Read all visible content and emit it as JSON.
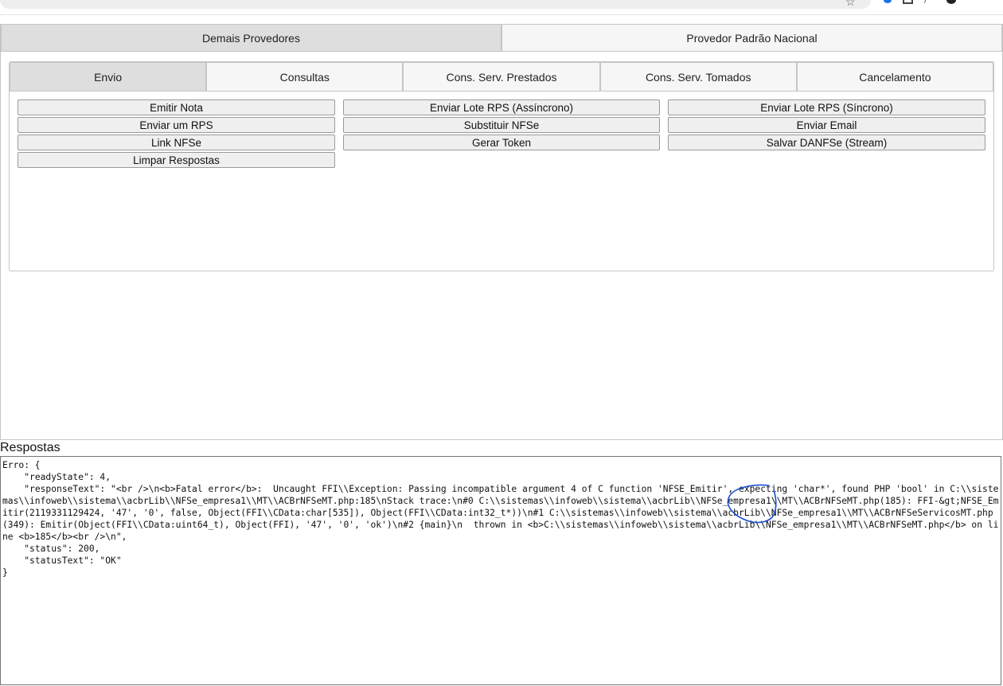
{
  "browser": {
    "star_glyph": "☆"
  },
  "top_tabs": [
    {
      "label": "Demais Provedores",
      "active": true
    },
    {
      "label": "Provedor Padrão Nacional",
      "active": false
    }
  ],
  "sub_tabs": [
    {
      "label": "Envio",
      "active": true
    },
    {
      "label": "Consultas",
      "active": false
    },
    {
      "label": "Cons. Serv. Prestados",
      "active": false
    },
    {
      "label": "Cons. Serv. Tomados",
      "active": false
    },
    {
      "label": "Cancelamento",
      "active": false
    }
  ],
  "buttons": {
    "emitir_nota": "Emitir Nota",
    "enviar_lote_async": "Enviar Lote RPS (Assíncrono)",
    "enviar_lote_sync": "Enviar Lote RPS (Síncrono)",
    "enviar_rps": "Enviar um RPS",
    "substituir": "Substituir NFSe",
    "enviar_email": "Enviar Email",
    "link": "Link NFSe",
    "gerar_token": "Gerar Token",
    "salvar_danfse": "Salvar DANFSe (Stream)",
    "limpar": "Limpar Respostas"
  },
  "respostas": {
    "label": "Respostas",
    "text": "Erro: {\n    \"readyState\": 4,\n    \"responseText\": \"<br />\\n<b>Fatal error</b>:  Uncaught FFI\\\\Exception: Passing incompatible argument 4 of C function 'NFSE_Emitir', expecting 'char*', found PHP 'bool' in C:\\\\sistemas\\\\infoweb\\\\sistema\\\\acbrLib\\\\NFSe_empresa1\\\\MT\\\\ACBrNFSeMT.php:185\\nStack trace:\\n#0 C:\\\\sistemas\\\\infoweb\\\\sistema\\\\acbrLib\\\\NFSe_empresa1\\\\MT\\\\ACBrNFSeMT.php(185): FFI-&gt;NFSE_Emitir(2119331129424, '47', '0', false, Object(FFI\\\\CData:char[535]), Object(FFI\\\\CData:int32_t*))\\n#1 C:\\\\sistemas\\\\infoweb\\\\sistema\\\\acbrLib\\\\NFSe_empresa1\\\\MT\\\\ACBrNFSeServicosMT.php(349): Emitir(Object(FFI\\\\CData:uint64_t), Object(FFI), '47', '0', 'ok')\\n#2 {main}\\n  thrown in <b>C:\\\\sistemas\\\\infoweb\\\\sistema\\\\acbrLib\\\\NFSe_empresa1\\\\MT\\\\ACBrNFSeMT.php</b> on line <b>185</b><br />\\n\",\n    \"status\": 200,\n    \"statusText\": \"OK\"\n}"
  },
  "colors": {
    "annotation": "#1a4fd6",
    "active_tab": "#dedede",
    "inactive_tab": "#f6f6f6"
  }
}
